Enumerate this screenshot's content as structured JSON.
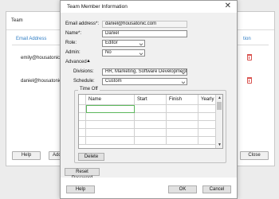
{
  "background_window": {
    "title": "Team",
    "columns": {
      "email": "Email Address",
      "action_partial": "tion"
    },
    "rows": [
      {
        "email": "emily@housatonic.com"
      },
      {
        "email": "daniel@housatonic.com"
      }
    ],
    "buttons": {
      "help": "Help",
      "add_partial": "Add",
      "close": "Close"
    }
  },
  "dialog": {
    "title": "Team Member Information",
    "close_glyph": "✕",
    "fields": {
      "email": {
        "label": "Email address*:",
        "value": "daniel@housatonic.com"
      },
      "name": {
        "label": "Name*:",
        "value": "Daniel"
      },
      "role": {
        "label": "Role:",
        "value": "Editor"
      },
      "admin": {
        "label": "Admin:",
        "value": "No"
      }
    },
    "advanced": {
      "label": "Advanced",
      "toggle": "▲"
    },
    "divisions": {
      "label": "Divisions:",
      "value": "HR, Marketing, Software Development"
    },
    "schedule": {
      "label": "Schedule:",
      "value": "Custom"
    },
    "time_off": {
      "title": "Time Off",
      "columns": [
        "Name",
        "Start",
        "Finish",
        "Yearly"
      ],
      "delete_label": "Delete"
    },
    "reset_password_label": "Reset Password",
    "help_label": "Help",
    "ok_label": "OK",
    "cancel_label": "Cancel",
    "scroll_up": "▲",
    "scroll_down": "▼"
  }
}
